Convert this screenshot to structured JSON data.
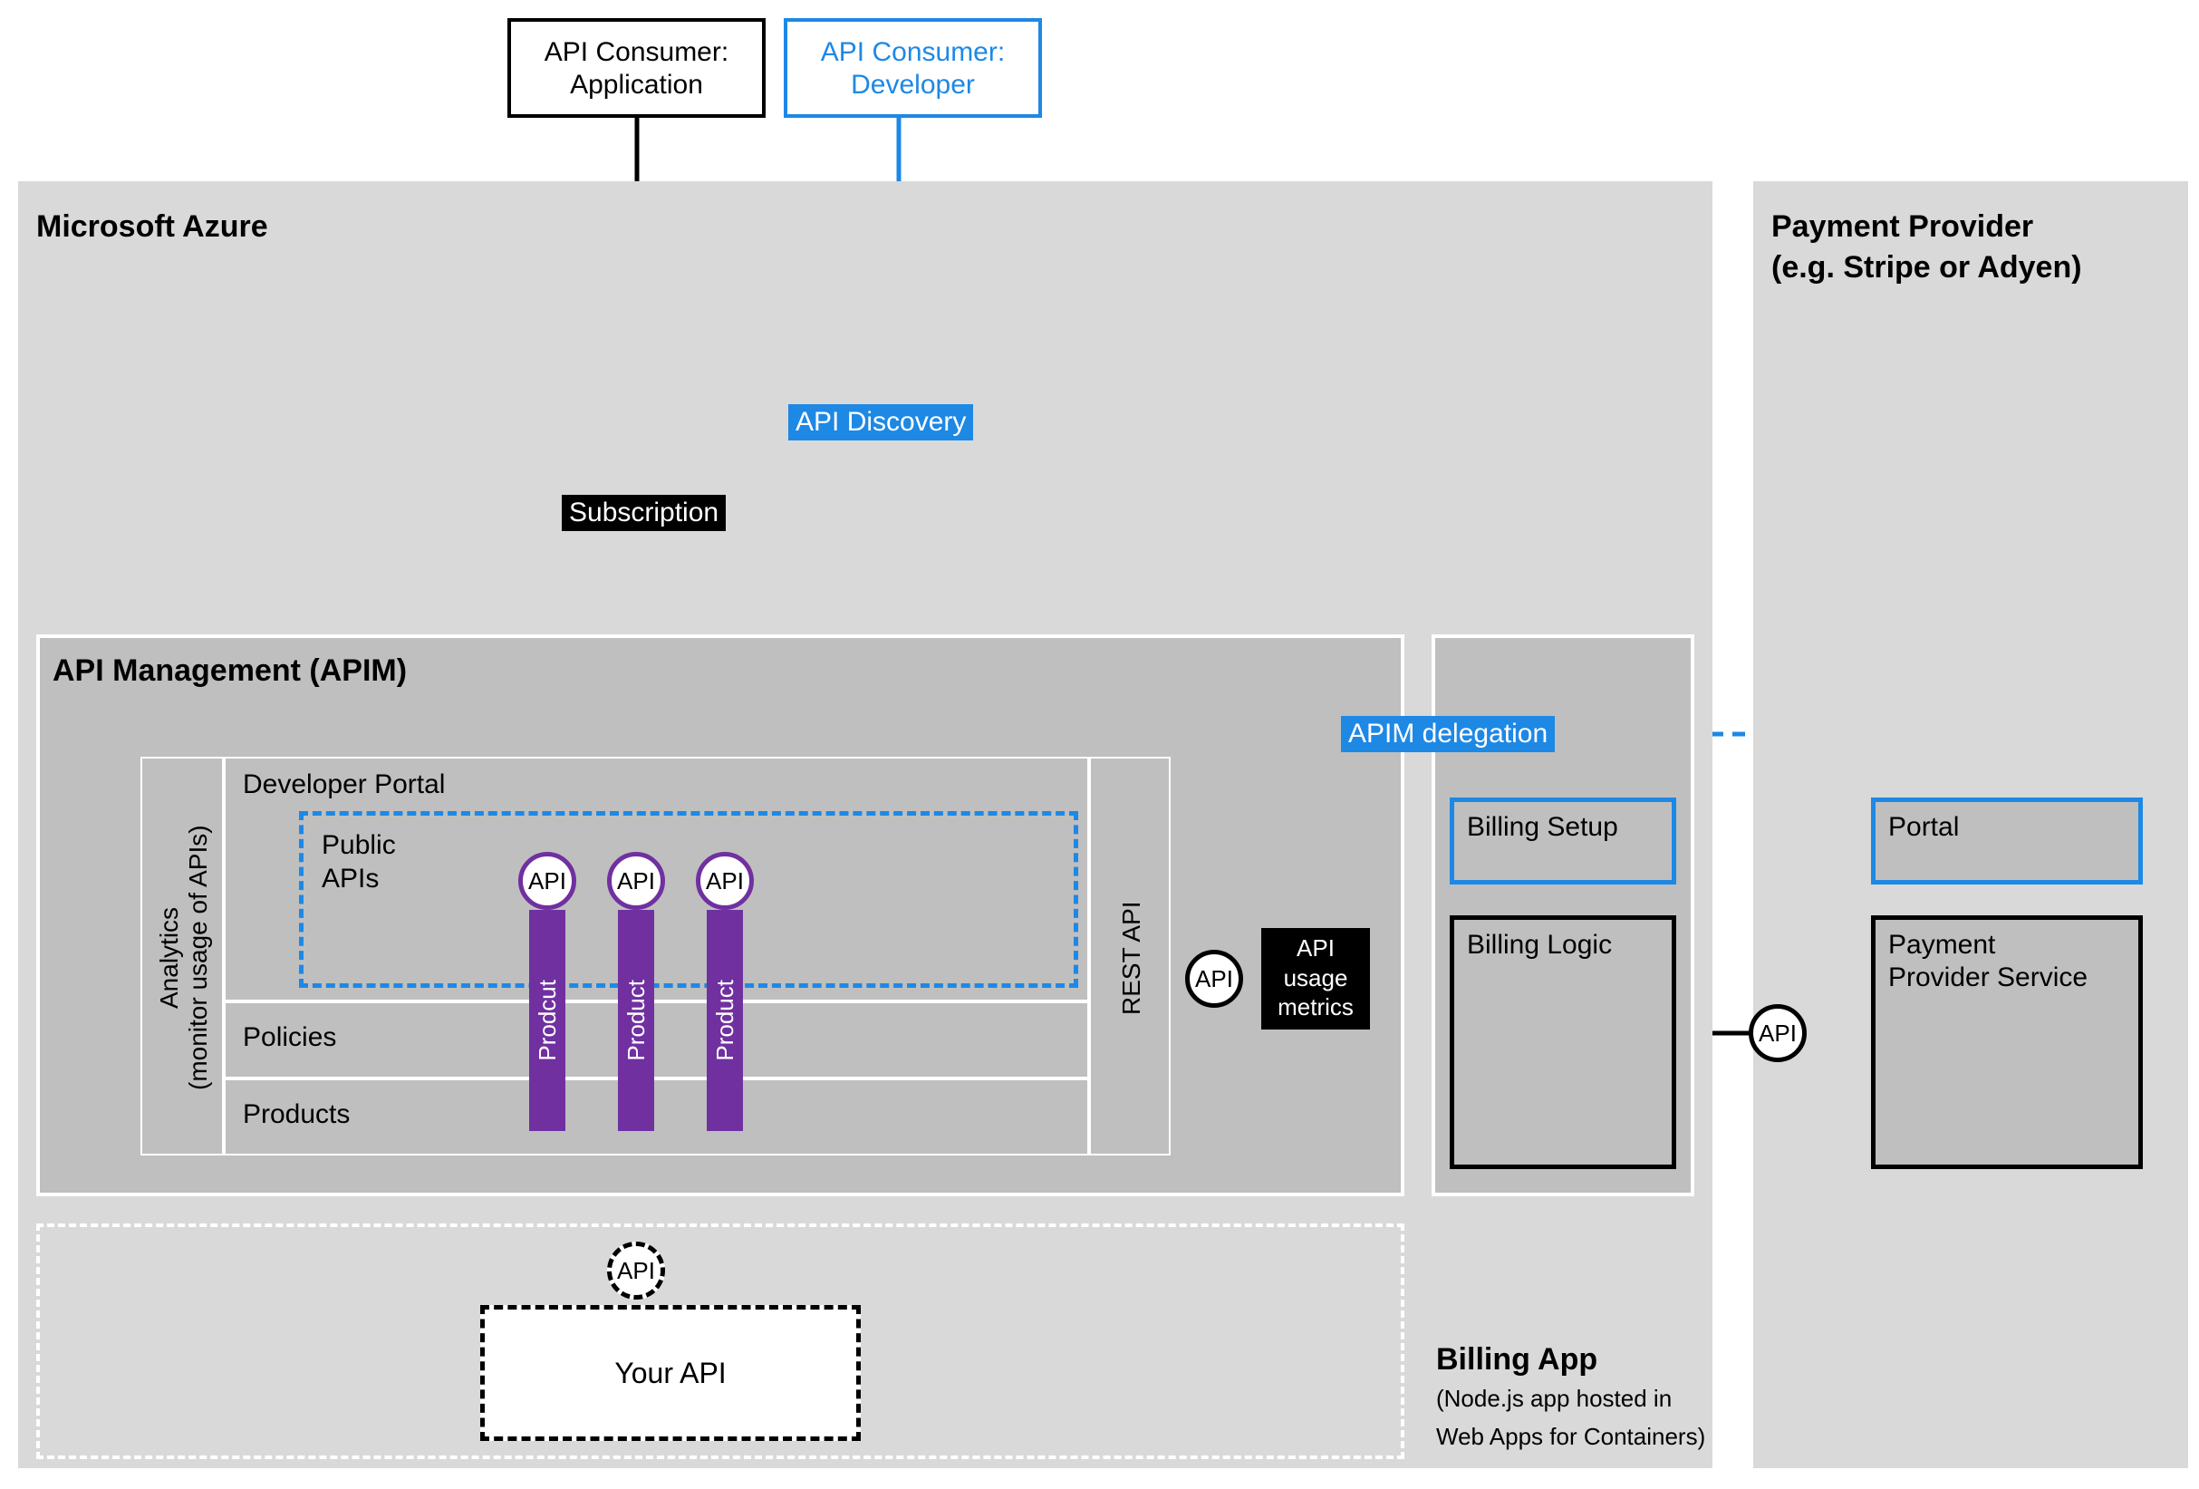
{
  "consumers": {
    "application": {
      "line1": "API Consumer:",
      "line2": "Application"
    },
    "developer": {
      "line1": "API Consumer:",
      "line2": "Developer"
    }
  },
  "azure": {
    "title": "Microsoft Azure"
  },
  "paymentProvider": {
    "title1": "Payment Provider",
    "title2": "(e.g. Stripe or Adyen)",
    "portal": "Portal",
    "service1": "Payment",
    "service2": "Provider Service"
  },
  "apim": {
    "title": "API Management (APIM)",
    "analytics1": "Analytics",
    "analytics2": "(monitor usage of APIs)",
    "devPortal": "Developer Portal",
    "publicApis1": "Public",
    "publicApis2": "APIs",
    "policies": "Policies",
    "products": "Products",
    "restApi": "REST API"
  },
  "api": "API",
  "product": "Product",
  "productTypo": "Prodcut",
  "yourApi": "Your API",
  "billingApp": {
    "title": "Billing App",
    "sub1": "(Node.js app hosted in",
    "sub2": "Web Apps for Containers)",
    "setup": "Billing Setup",
    "logic": "Billing Logic"
  },
  "tags": {
    "subscription": "Subscription",
    "apiDiscovery": "API Discovery",
    "apimDelegation": "APIM delegation",
    "usage1": "API",
    "usage2": "usage",
    "usage3": "metrics"
  }
}
